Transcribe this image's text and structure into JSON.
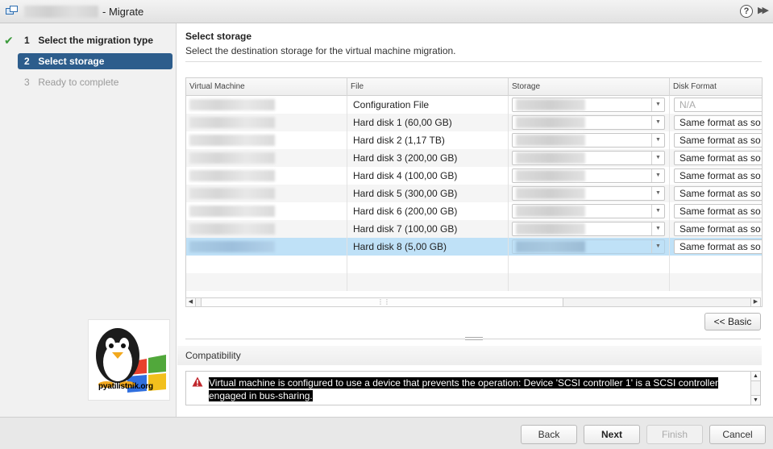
{
  "window": {
    "title": "- Migrate",
    "help_icon": "?",
    "expand_icon": "double-chevron-right-icon"
  },
  "steps": [
    {
      "num": "1",
      "label": "Select the migration type",
      "state": "done"
    },
    {
      "num": "2",
      "label": "Select storage",
      "state": "active"
    },
    {
      "num": "3",
      "label": "Ready to complete",
      "state": "pending"
    }
  ],
  "logo": {
    "text": "pyatilistnik.org"
  },
  "page": {
    "title": "Select storage",
    "subtitle": "Select the destination storage for the virtual machine migration."
  },
  "table": {
    "columns": [
      "Virtual Machine",
      "File",
      "Storage",
      "Disk Format"
    ],
    "rows": [
      {
        "file": "Configuration File",
        "format": "N/A"
      },
      {
        "file": "Hard disk 1 (60,00 GB)",
        "format": "Same format as so"
      },
      {
        "file": "Hard disk 2 (1,17 TB)",
        "format": "Same format as so"
      },
      {
        "file": "Hard disk 3 (200,00 GB)",
        "format": "Same format as so"
      },
      {
        "file": "Hard disk 4 (100,00 GB)",
        "format": "Same format as so"
      },
      {
        "file": "Hard disk 5 (300,00 GB)",
        "format": "Same format as so"
      },
      {
        "file": "Hard disk 6 (200,00 GB)",
        "format": "Same format as so"
      },
      {
        "file": "Hard disk 7 (100,00 GB)",
        "format": "Same format as so"
      },
      {
        "file": "Hard disk 8 (5,00 GB)",
        "format": "Same format as so"
      }
    ],
    "selected_row": 8
  },
  "basic_button": "<< Basic",
  "compatibility": {
    "title": "Compatibility",
    "message_line1": "Virtual machine is configured to use a device that prevents the operation: Device 'SCSI controller 1' is a SCSI controller",
    "message_line2": "engaged in bus-sharing."
  },
  "footer": {
    "back": "Back",
    "next": "Next",
    "finish": "Finish",
    "cancel": "Cancel"
  },
  "colors": {
    "active_step": "#2d5d8c",
    "selected_row": "#bfe1f7",
    "done_check": "#3c9b3c",
    "error": "#c0272d"
  }
}
